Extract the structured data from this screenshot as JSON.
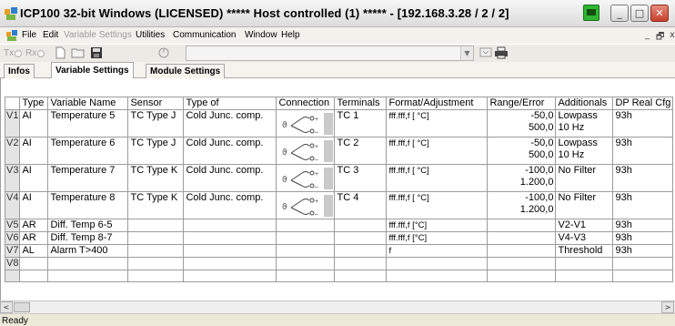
{
  "window": {
    "title": "ICP100 32-bit Windows  (LICENSED)  *****  Host controlled (1)  *****   - [192.168.3.28  / 2 / 2]",
    "minimize_glyph": "_",
    "restore_glyph": "□",
    "close_glyph": "✕"
  },
  "menubar": {
    "items": [
      "File",
      "Edit",
      "Variable Settings",
      "Utilities",
      "Communication",
      "Window",
      "Help"
    ],
    "mdi_min": "_",
    "mdi_restore": "🗗",
    "mdi_close": "x"
  },
  "toolbar": {
    "tx_label": "Tx",
    "rx_label": "Rx",
    "combo_value": "",
    "icons": [
      "new-file-icon",
      "open-folder-icon",
      "save-disk-icon",
      "settings-dial-icon",
      "monitor-icon",
      "print-icon"
    ]
  },
  "tabs": [
    {
      "label": "Infos",
      "active": false
    },
    {
      "label": "Variable Settings",
      "active": true
    },
    {
      "label": "Module Settings",
      "active": false
    }
  ],
  "grid": {
    "columns": [
      "",
      "Type",
      "Variable Name",
      "Sensor",
      "Type of",
      "Connection",
      "Terminals",
      "Format/Adjustment",
      "Range/Error",
      "Additionals",
      "DP Real Cfg"
    ],
    "rows": [
      {
        "id": "V1",
        "type": "AI",
        "name": "Temperature 5",
        "sensor": "TC Type J",
        "type_of": "Cold Junc. comp.",
        "terminals": "TC 1",
        "format": "fff.fff,f [ °C]",
        "range1": "-50,0",
        "range2": "500,0",
        "add1": "Lowpass",
        "add2": "10 Hz",
        "dp": "93h",
        "tc": true
      },
      {
        "id": "V2",
        "type": "AI",
        "name": "Temperature 6",
        "sensor": "TC Type J",
        "type_of": "Cold Junc. comp.",
        "terminals": "TC 2",
        "format": "fff.fff,f [ °C]",
        "range1": "-50,0",
        "range2": "500,0",
        "add1": "Lowpass",
        "add2": "10 Hz",
        "dp": "93h",
        "tc": true
      },
      {
        "id": "V3",
        "type": "AI",
        "name": "Temperature 7",
        "sensor": "TC Type K",
        "type_of": "Cold Junc. comp.",
        "terminals": "TC 3",
        "format": "fff.fff,f [ °C]",
        "range1": "-100,0",
        "range2": "1.200,0",
        "add1": "No Filter",
        "add2": "",
        "dp": "93h",
        "tc": true
      },
      {
        "id": "V4",
        "type": "AI",
        "name": "Temperature 8",
        "sensor": "TC Type K",
        "type_of": "Cold Junc. comp.",
        "terminals": "TC 4",
        "format": "fff.fff,f [ °C]",
        "range1": "-100,0",
        "range2": "1.200,0",
        "add1": "No Filter",
        "add2": "",
        "dp": "93h",
        "tc": true
      },
      {
        "id": "V5",
        "type": "AR",
        "name": "Diff. Temp 6-5",
        "sensor": "",
        "type_of": "",
        "terminals": "",
        "format": "fff.fff,f [°C]",
        "range1": "",
        "range2": "",
        "add1": "V2-V1",
        "add2": "",
        "dp": "93h",
        "tc": false
      },
      {
        "id": "V6",
        "type": "AR",
        "name": "Diff. Temp 8-7",
        "sensor": "",
        "type_of": "",
        "terminals": "",
        "format": "fff.fff,f [°C]",
        "range1": "",
        "range2": "",
        "add1": "V4-V3",
        "add2": "",
        "dp": "93h",
        "tc": false
      },
      {
        "id": "V7",
        "type": "AL",
        "name": "Alarm T>400",
        "sensor": "",
        "type_of": "",
        "terminals": "",
        "format": "f",
        "range1": "",
        "range2": "",
        "add1": "Threshold",
        "add2": "",
        "dp": "93h",
        "tc": false
      },
      {
        "id": "V8",
        "type": "",
        "name": "",
        "sensor": "",
        "type_of": "",
        "terminals": "",
        "format": "",
        "range1": "",
        "range2": "",
        "add1": "",
        "add2": "",
        "dp": "",
        "tc": false
      },
      {
        "id": "",
        "type": "",
        "name": "",
        "sensor": "",
        "type_of": "",
        "terminals": "",
        "format": "",
        "range1": "",
        "range2": "",
        "add1": "",
        "add2": "",
        "dp": "",
        "tc": false
      }
    ]
  },
  "scrollbar": {
    "left_arrow": "<",
    "right_arrow": ">"
  },
  "status": {
    "text": "Ready"
  }
}
